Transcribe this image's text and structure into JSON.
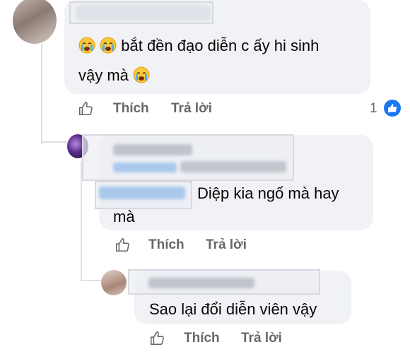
{
  "comments": [
    {
      "text_line1": "bắt đền đạo diễn c ấy hi sinh",
      "text_line2": "vậy mà",
      "actions": {
        "like": "Thích",
        "reply": "Trả lời"
      },
      "reaction_count": "1"
    },
    {
      "text_line1": "Diệp kia ngố mà hay",
      "text_line2": "mà",
      "actions": {
        "like": "Thích",
        "reply": "Trả lời"
      }
    },
    {
      "text": "Sao lại đổi diễn viên vậy",
      "actions": {
        "like": "Thích",
        "reply": "Trả lời"
      }
    }
  ],
  "icons": {
    "emoji": "crying-emoji",
    "like_action": "thumbs-up-outline-icon",
    "reaction": "like-reaction-icon"
  },
  "colors": {
    "bubble": "#f0f2f5",
    "action_text": "#65676b",
    "like_blue": "#1877f2"
  }
}
